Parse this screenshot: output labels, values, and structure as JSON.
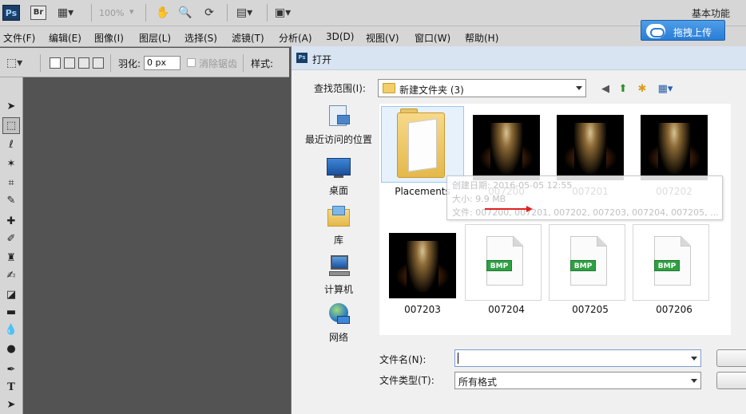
{
  "app": {
    "logo": "Ps",
    "bridge": "Br",
    "zoom": "100%",
    "workspace": "基本功能"
  },
  "menu": [
    "文件(F)",
    "编辑(E)",
    "图像(I)",
    "图层(L)",
    "选择(S)",
    "滤镜(T)",
    "分析(A)",
    "3D(D)",
    "视图(V)",
    "窗口(W)",
    "帮助(H)"
  ],
  "upload_button": "拖拽上传",
  "options_bar": {
    "feather_label": "羽化:",
    "feather_value": "0 px",
    "antialias_label": "消除锯齿",
    "style_label": "样式:"
  },
  "dialog": {
    "title": "打开",
    "lookin_label": "查找范围(I):",
    "lookin_value": "新建文件夹 (3)",
    "places": [
      {
        "label": "最近访问的位置",
        "icon": "recent-places-icon"
      },
      {
        "label": "桌面",
        "icon": "desktop-icon"
      },
      {
        "label": "库",
        "icon": "library-icon"
      },
      {
        "label": "计算机",
        "icon": "computer-icon"
      },
      {
        "label": "网络",
        "icon": "network-icon"
      }
    ],
    "files": [
      {
        "name": "Placements",
        "kind": "folder"
      },
      {
        "name": "007200",
        "kind": "image"
      },
      {
        "name": "007201",
        "kind": "image"
      },
      {
        "name": "007202",
        "kind": "image"
      },
      {
        "name": "007203",
        "kind": "image"
      },
      {
        "name": "007204",
        "kind": "bmp"
      },
      {
        "name": "007205",
        "kind": "bmp"
      },
      {
        "name": "007206",
        "kind": "bmp"
      }
    ],
    "bmp_badge": "BMP",
    "tooltip": {
      "created": "创建日期: 2016-05-05 12:55",
      "size": "大小: 9.9 MB",
      "files": "文件: 007200, 007201, 007202, 007203, 007204, 007205, ..."
    },
    "filename_label": "文件名(N):",
    "filename_value": "",
    "filetype_label": "文件类型(T):",
    "filetype_value": "所有格式"
  },
  "colors": {
    "accent": "#2a7dd6",
    "badge": "#2ea043",
    "arrow": "#e02020"
  }
}
